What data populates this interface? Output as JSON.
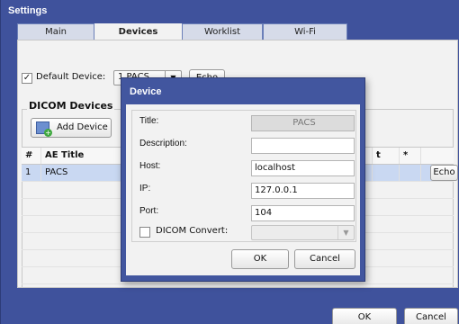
{
  "window": {
    "title": "Settings"
  },
  "tabs": [
    {
      "label": "Main"
    },
    {
      "label": "Devices"
    },
    {
      "label": "Worklist"
    },
    {
      "label": "Wi-Fi"
    }
  ],
  "devices": {
    "default_device_label": "Default Device:",
    "default_device_checked": true,
    "default_device_value": "1 PACS",
    "echo_label": "Echo",
    "group_title": "DICOM Devices",
    "add_device_label": "Add Device",
    "table": {
      "headers": {
        "num": "#",
        "ae_title": "AE Title",
        "port_suffix": "t",
        "star": "*"
      },
      "rows": [
        {
          "num": "1",
          "ae_title": "PACS",
          "echo": "Echo",
          "selected": true
        }
      ]
    }
  },
  "dialog": {
    "title": "Device",
    "title_label": "Title:",
    "title_value": "PACS",
    "description_label": "Description:",
    "description_value": "",
    "host_label": "Host:",
    "host_value": "localhost",
    "ip_label": "IP:",
    "ip_value": "127.0.0.1",
    "port_label": "Port:",
    "port_value": "104",
    "dicom_convert_label": "DICOM Convert:",
    "dicom_convert_checked": false,
    "ok_label": "OK",
    "cancel_label": "Cancel"
  },
  "footer": {
    "ok_label": "OK",
    "cancel_label": "Cancel"
  },
  "colors": {
    "window_blue": "#3f529c",
    "selection": "#c9d8f2"
  },
  "icons": {
    "add_device": "add-device-icon",
    "checkmark": "checkmark-icon",
    "dropdown": "chevron-down-icon"
  }
}
